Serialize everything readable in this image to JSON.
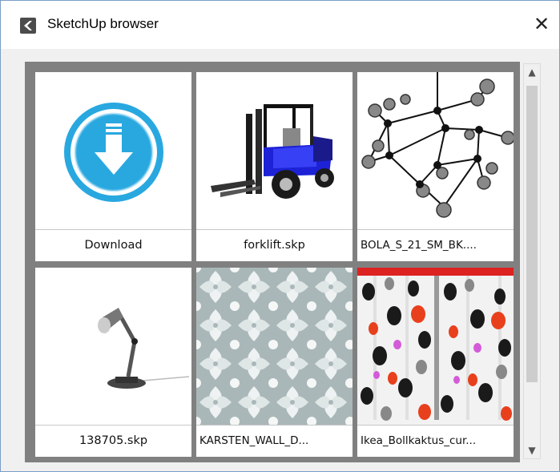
{
  "window": {
    "title": "SketchUp browser",
    "close_glyph": "✕"
  },
  "gallery": {
    "items": [
      {
        "label": "Download",
        "icon": "download-icon"
      },
      {
        "label": "forklift.skp",
        "icon": "forklift-model"
      },
      {
        "label": "BOLA_S_21_SM_BK....",
        "icon": "chandelier-model"
      },
      {
        "label": "138705.skp",
        "icon": "desk-lamp-model"
      },
      {
        "label": "KARSTEN_WALL_D...",
        "icon": "damask-wallpaper"
      },
      {
        "label": "Ikea_Bollkaktus_cur...",
        "icon": "polka-curtain"
      }
    ]
  },
  "scrollbar": {
    "up_glyph": "▲",
    "down_glyph": "▼"
  },
  "colors": {
    "accent": "#29a8e0",
    "frame": "#808080",
    "forklift": "#1d22d6"
  }
}
